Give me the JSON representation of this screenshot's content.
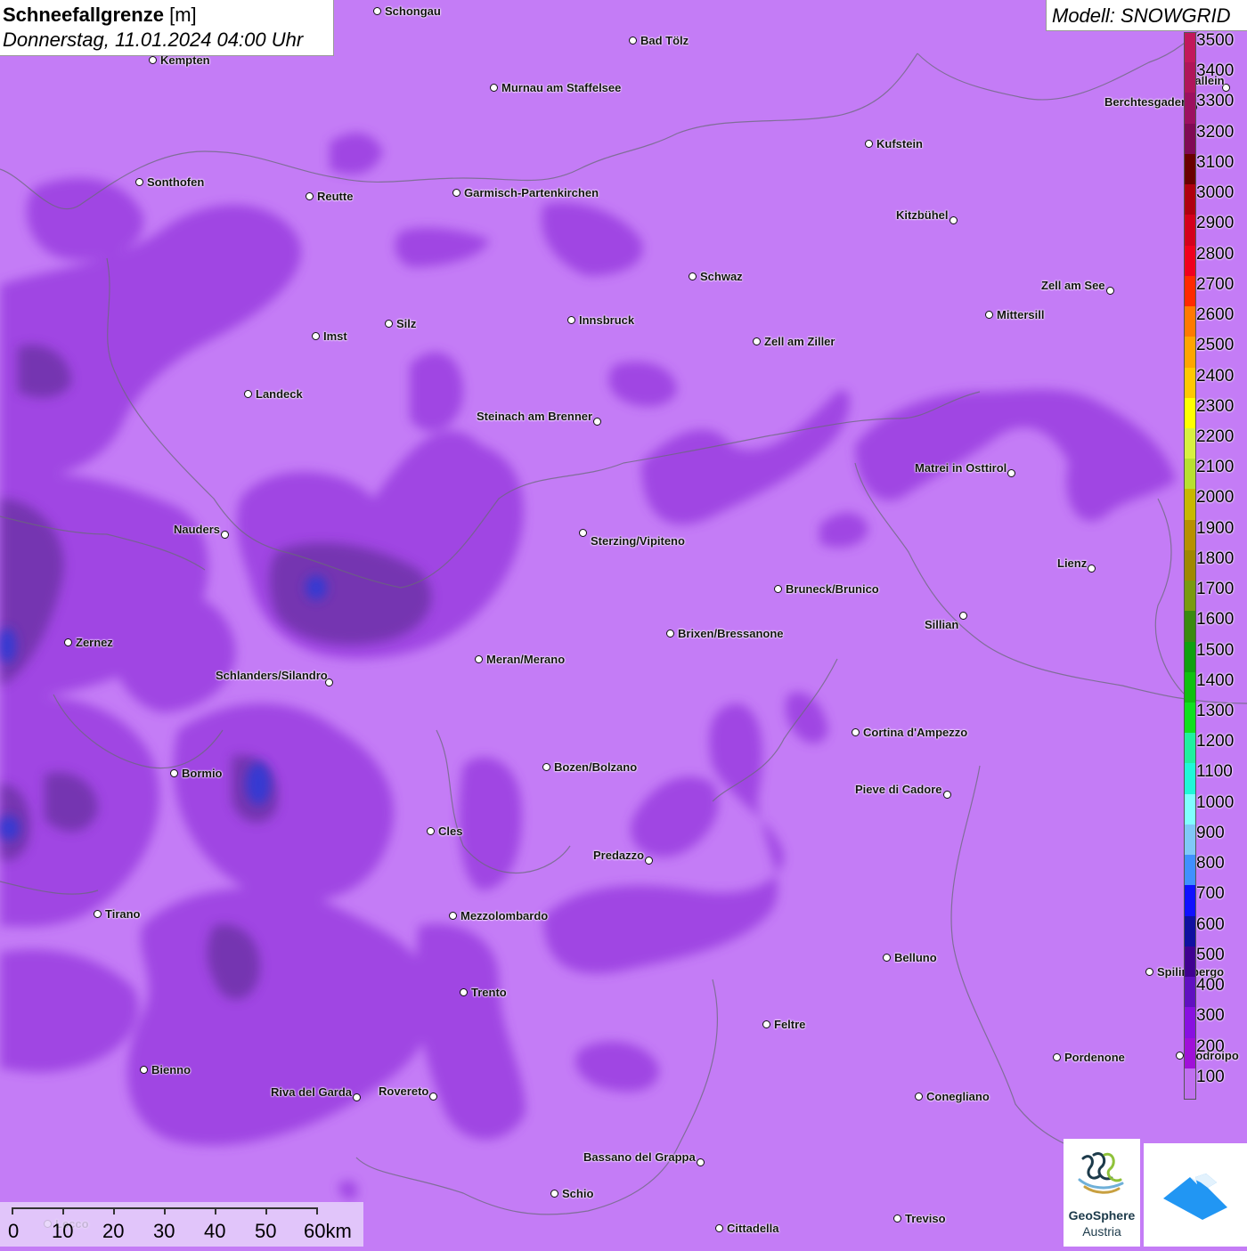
{
  "header": {
    "title": "Schneefallgrenze",
    "unit": "[m]",
    "datetime": "Donnerstag, 11.01.2024 04:00 Uhr",
    "model": "Modell: SNOWGRID"
  },
  "legend": {
    "levels": [
      "3500",
      "3400",
      "3300",
      "3200",
      "3100",
      "3000",
      "2900",
      "2800",
      "2700",
      "2600",
      "2500",
      "2400",
      "2300",
      "2200",
      "2100",
      "2000",
      "1900",
      "1800",
      "1700",
      "1600",
      "1500",
      "1400",
      "1300",
      "1200",
      "1100",
      "1000",
      "900",
      "800",
      "700",
      "600",
      "500",
      "400",
      "300",
      "200",
      "100"
    ],
    "colors": [
      "#c2185b",
      "#b0155a",
      "#9c1060",
      "#800a55",
      "#6a0000",
      "#b00010",
      "#d4001c",
      "#f0001e",
      "#ff2a00",
      "#ff7a00",
      "#ffa500",
      "#ffc800",
      "#ffff00",
      "#d8f040",
      "#b8e030",
      "#c8b800",
      "#b89000",
      "#a08800",
      "#7a9a10",
      "#3a8a10",
      "#10a010",
      "#10c010",
      "#10e020",
      "#20f0a0",
      "#20f8d8",
      "#80ffff",
      "#80c8f8",
      "#4090ff",
      "#1010ff",
      "#1010a0",
      "#400090",
      "#6010c0",
      "#8810e0",
      "#a010d8",
      "#c070f0"
    ]
  },
  "map": {
    "background_color": "#c47cf6",
    "cities": [
      {
        "name": "Schongau"
      },
      {
        "name": "Bad Tölz"
      },
      {
        "name": "Kempten"
      },
      {
        "name": "Murnau am Staffelsee"
      },
      {
        "name": "Berchtesgaden"
      },
      {
        "name": "Kufstein"
      },
      {
        "name": "Sonthofen"
      },
      {
        "name": "Reutte"
      },
      {
        "name": "Garmisch-Partenkirchen"
      },
      {
        "name": "Kitzbühel"
      },
      {
        "name": "Schwaz"
      },
      {
        "name": "Zell am See"
      },
      {
        "name": "Innsbruck"
      },
      {
        "name": "Mittersill"
      },
      {
        "name": "Silz"
      },
      {
        "name": "Imst"
      },
      {
        "name": "Zell am Ziller"
      },
      {
        "name": "Landeck"
      },
      {
        "name": "Steinach am Brenner"
      },
      {
        "name": "Matrei in Osttirol"
      },
      {
        "name": "Nauders"
      },
      {
        "name": "Sterzing/Vipiteno"
      },
      {
        "name": "Lienz"
      },
      {
        "name": "Bruneck/Brunico"
      },
      {
        "name": "Sillian"
      },
      {
        "name": "Zernez"
      },
      {
        "name": "Brixen/Bressanone"
      },
      {
        "name": "Meran/Merano"
      },
      {
        "name": "Schlanders/Silandro"
      },
      {
        "name": "Cortina d'Ampezzo"
      },
      {
        "name": "Bozen/Bolzano"
      },
      {
        "name": "Bormio"
      },
      {
        "name": "Pieve di Cadore"
      },
      {
        "name": "Cles"
      },
      {
        "name": "Predazzo"
      },
      {
        "name": "Tirano"
      },
      {
        "name": "Mezzolombardo"
      },
      {
        "name": "Belluno"
      },
      {
        "name": "Spilimbergo"
      },
      {
        "name": "Trento"
      },
      {
        "name": "Feltre"
      },
      {
        "name": "Pordenone"
      },
      {
        "name": "Bienno"
      },
      {
        "name": "Riva del Garda"
      },
      {
        "name": "Rovereto"
      },
      {
        "name": "Conegliano"
      },
      {
        "name": "Bassano del Grappa"
      },
      {
        "name": "Schio"
      },
      {
        "name": "Treviso"
      },
      {
        "name": "Cittadella"
      },
      {
        "name": "Hallein"
      },
      {
        "name": "Codroipo"
      },
      {
        "name": "Lecco"
      }
    ]
  },
  "scale_bar": {
    "labels": [
      "0",
      "10",
      "20",
      "30",
      "40",
      "50",
      "60km"
    ]
  },
  "logos": {
    "geosphere_name": "GeoSphere",
    "geosphere_sub": "Austria"
  }
}
